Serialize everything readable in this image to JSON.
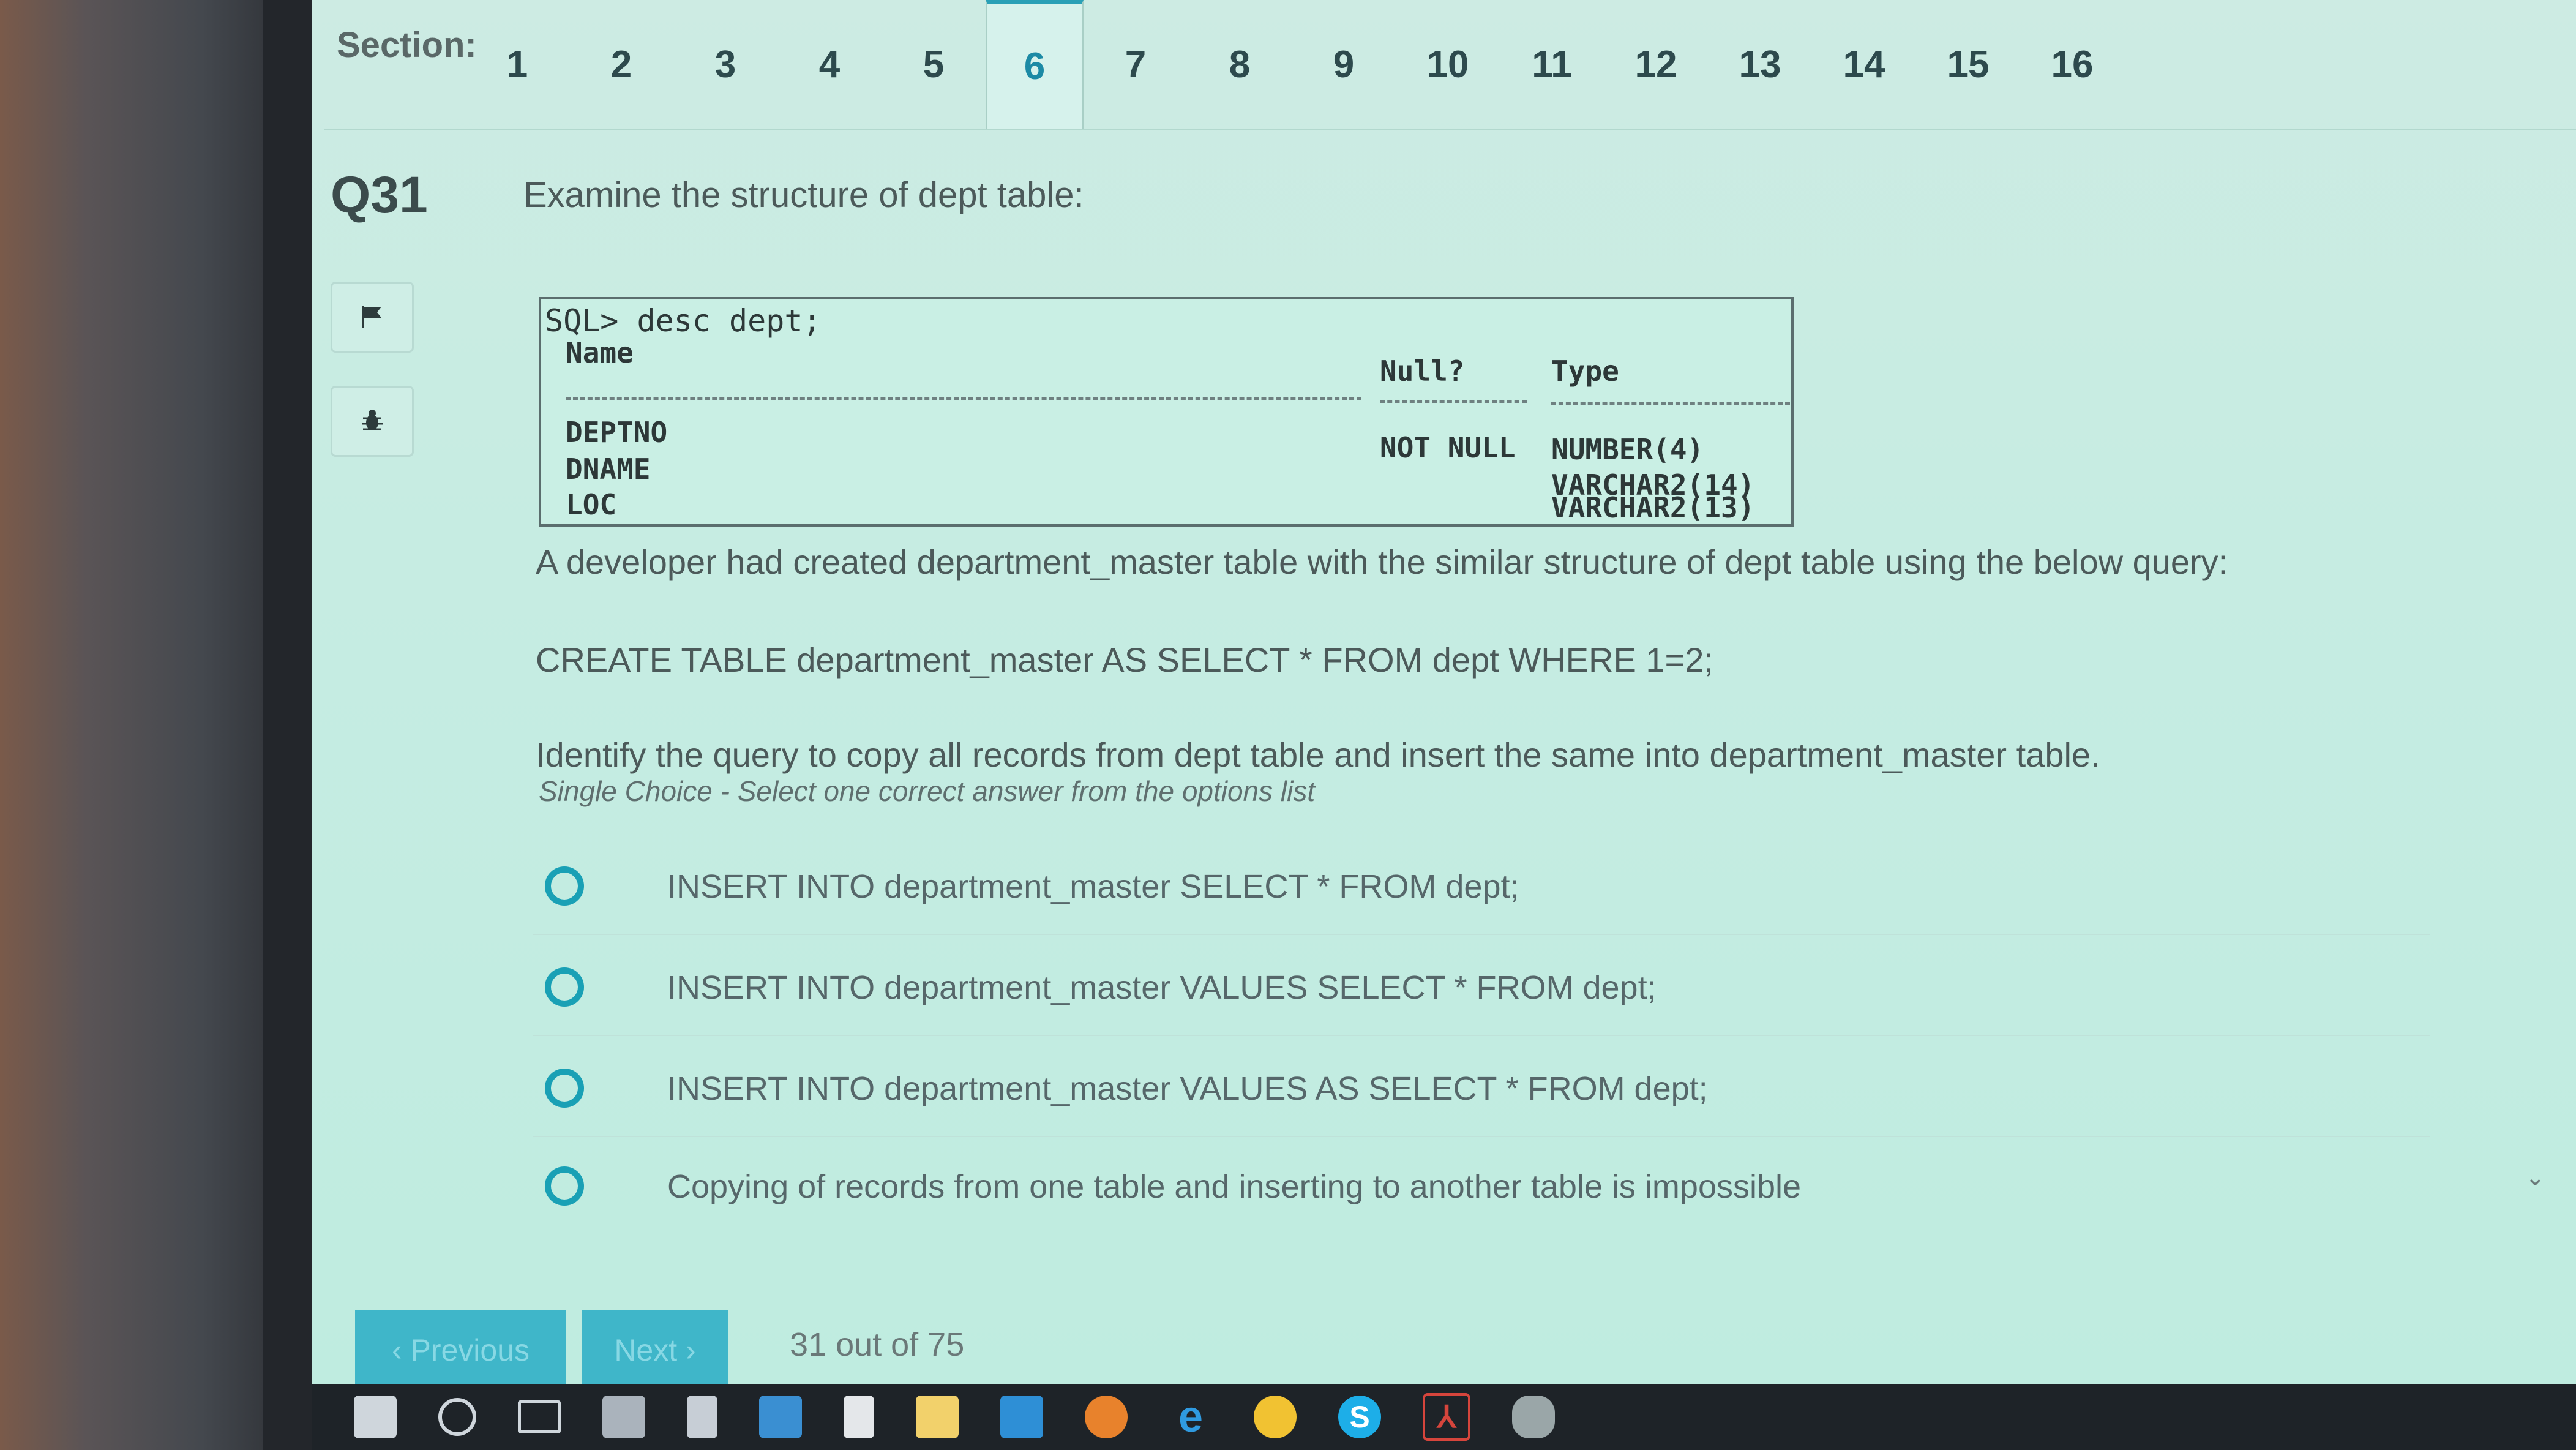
{
  "section": {
    "label": "Section:",
    "tabs": [
      "1",
      "2",
      "3",
      "4",
      "5",
      "6",
      "7",
      "8",
      "9",
      "10",
      "11",
      "12",
      "13",
      "14",
      "15",
      "16"
    ],
    "active": "6"
  },
  "question": {
    "number": "Q31",
    "prompt": "Examine the structure of dept table:",
    "desc": {
      "command": "SQL> desc dept;",
      "col_name": "Name",
      "col_null": "Null?",
      "col_type": "Type",
      "rows": [
        {
          "name": "DEPTNO",
          "null": "NOT NULL",
          "type": "NUMBER(4)"
        },
        {
          "name": "DNAME",
          "null": "",
          "type": "VARCHAR2(14)"
        },
        {
          "name": "LOC",
          "null": "",
          "type": "VARCHAR2(13)"
        }
      ]
    },
    "para1": "A developer had created department_master table with the similar structure of dept table using the below query:",
    "para2": "CREATE TABLE department_master AS SELECT * FROM dept WHERE 1=2;",
    "para3": "Identify the query to copy all records from dept table and insert the same into department_master table.",
    "hint": "Single Choice - Select one correct answer from the options list",
    "options": [
      "INSERT INTO department_master SELECT * FROM dept;",
      "INSERT INTO department_master VALUES SELECT * FROM dept;",
      "INSERT INTO department_master VALUES AS SELECT * FROM dept;",
      "Copying of records from one table and inserting to another table is impossible"
    ]
  },
  "nav": {
    "previous": "‹ Previous",
    "next": "Next ›",
    "progress": "31 out of 75"
  },
  "icons": {
    "flag": "flag-icon",
    "bug": "bug-icon",
    "taskbar": [
      "windows-icon",
      "search-icon",
      "task-view-icon",
      "store-icon",
      "calculator-icon",
      "screen-icon",
      "file-icon",
      "folder-icon",
      "monitor-icon",
      "firefox-icon",
      "edge-icon",
      "chrome-icon",
      "skype-icon",
      "acrobat-icon",
      "app-icon"
    ]
  },
  "colors": {
    "accent": "#19a0b5",
    "screen_bg": "#c6ece2",
    "button_bg": "#3fb6c9"
  }
}
